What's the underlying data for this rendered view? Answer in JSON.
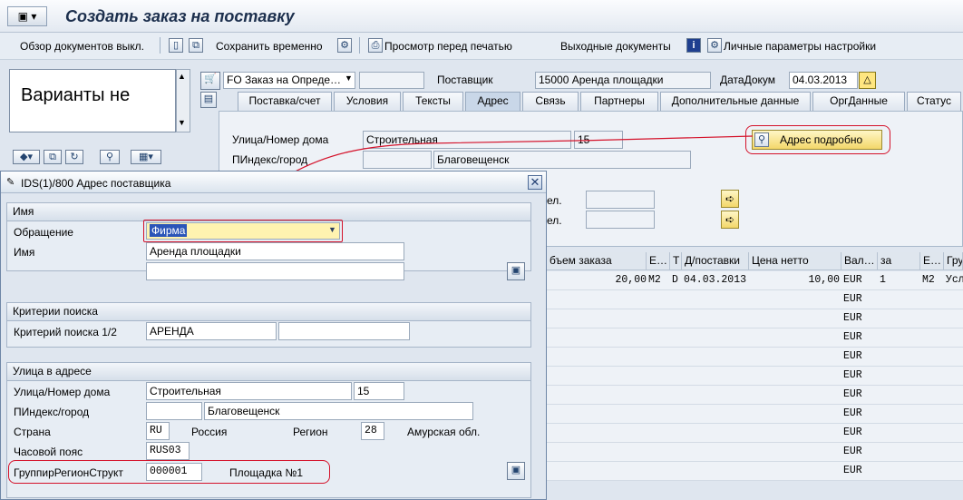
{
  "window": {
    "title": "Создать заказ на поставку"
  },
  "toolbar": {
    "doc_overview": "Обзор документов выкл.",
    "save_temp": "Сохранить временно",
    "print_preview": "Просмотр перед печатью",
    "output_docs": "Выходные документы",
    "personal_settings": "Личные параметры настройки"
  },
  "left_panel": {
    "variants_text": "Варианты не"
  },
  "header": {
    "order_type": "FO Заказ на Опреде…",
    "supplier_label": "Поставщик",
    "supplier_value": "15000 Аренда площадки",
    "doc_date_label": "ДатаДокум",
    "doc_date_value": "04.03.2013"
  },
  "tabs": [
    {
      "label": "Поставка/счет"
    },
    {
      "label": "Условия"
    },
    {
      "label": "Тексты"
    },
    {
      "label": "Адрес",
      "active": true
    },
    {
      "label": "Связь"
    },
    {
      "label": "Партнеры"
    },
    {
      "label": "Дополнительные данные"
    },
    {
      "label": "ОргДанные"
    },
    {
      "label": "Статус"
    }
  ],
  "address_tab": {
    "street_label": "Улица/Номер дома",
    "street_value": "Строительная",
    "house_value": "15",
    "postal_label": "ПИндекс/город",
    "city_value": "Благовещенск",
    "detail_button": "Адрес подробно",
    "tel_label_1": "ел.",
    "tel_label_2": "ел."
  },
  "grid": {
    "headers": [
      "бъем заказа",
      "Е…",
      "Т",
      "Д/поставки",
      "Цена нетто",
      "Вал…",
      "за",
      "Е…",
      "Гру"
    ],
    "rows": [
      {
        "qty": "20,00",
        "unit": "M2",
        "t": "D",
        "date": "04.03.2013",
        "price": "10,00",
        "cur": "EUR",
        "per": "1",
        "unit2": "M2",
        "grp": "Усл"
      },
      {
        "cur": "EUR"
      },
      {
        "cur": "EUR"
      },
      {
        "cur": "EUR"
      },
      {
        "cur": "EUR"
      },
      {
        "cur": "EUR"
      },
      {
        "cur": "EUR"
      },
      {
        "cur": "EUR"
      },
      {
        "cur": "EUR"
      },
      {
        "cur": "EUR"
      },
      {
        "cur": "EUR"
      }
    ]
  },
  "dialog": {
    "title": "IDS(1)/800 Адрес поставщика",
    "name_group": {
      "heading": "Имя",
      "salutation_label": "Обращение",
      "salutation_value": "Фирма",
      "name_label": "Имя",
      "name_value": "Аренда площадки"
    },
    "search_group": {
      "heading": "Критерии поиска",
      "search_label": "Критерий поиска 1/2",
      "search_value": "АРЕНДА"
    },
    "street_group": {
      "heading": "Улица в адресе",
      "street_label": "Улица/Номер дома",
      "street_value": "Строительная",
      "house_value": "15",
      "postal_label": "ПИндекс/город",
      "city_value": "Благовещенск",
      "country_label": "Страна",
      "country_code": "RU",
      "country_name": "Россия",
      "region_label": "Регион",
      "region_code": "28",
      "region_name": "Амурская обл.",
      "tz_label": "Часовой пояс",
      "tz_value": "RUS03",
      "regstruct_label": "ГруппирРегионСтрукт",
      "regstruct_code": "000001",
      "regstruct_name": "Площадка №1"
    }
  },
  "colors": {
    "accent_red": "#d4122a",
    "title_blue": "#1c2f4d",
    "button_yellow": "#ffe680"
  }
}
